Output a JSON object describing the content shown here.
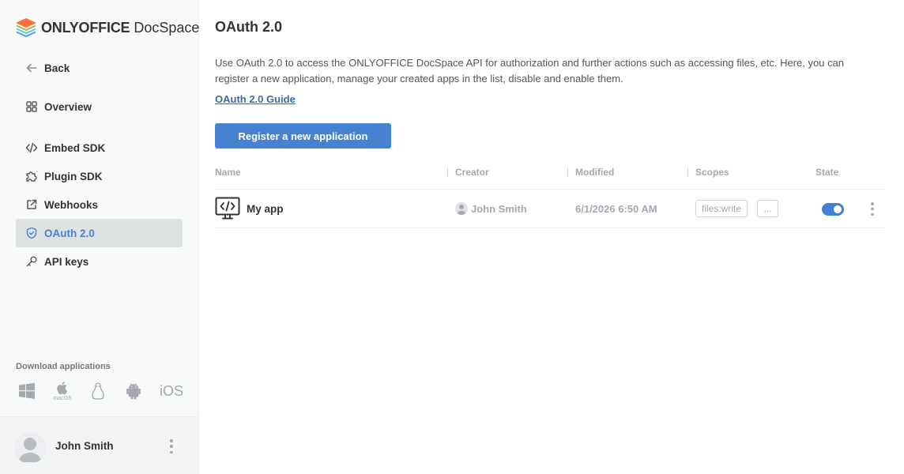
{
  "logo": {
    "brand_bold": "ONLYOFFICE",
    "brand_light": "DocSpace"
  },
  "sidebar": {
    "items": [
      {
        "label": "Back",
        "icon": "arrow-left-icon"
      },
      {
        "label": "Overview",
        "icon": "grid-icon"
      },
      {
        "label": "Embed SDK",
        "icon": "code-icon"
      },
      {
        "label": "Plugin SDK",
        "icon": "puzzle-icon"
      },
      {
        "label": "Webhooks",
        "icon": "external-link-icon"
      },
      {
        "label": "OAuth 2.0",
        "icon": "shield-check-icon",
        "active": true
      },
      {
        "label": "API keys",
        "icon": "key-icon"
      }
    ],
    "download_title": "Download applications",
    "apps": [
      {
        "name": "windows-icon"
      },
      {
        "name": "macos-icon",
        "label": "macOS"
      },
      {
        "name": "linux-icon"
      },
      {
        "name": "android-icon"
      },
      {
        "name": "ios-icon",
        "label": "iOS"
      }
    ]
  },
  "profile": {
    "name": "John Smith"
  },
  "main": {
    "title": "OAuth 2.0",
    "description": "Use OAuth 2.0 to access the ONLYOFFICE DocSpace API for authorization and further actions such as accessing files, etc. Here, you can register a new application, manage your created apps in the list, disable and enable them.",
    "guide_link": "OAuth 2.0 Guide",
    "register_button": "Register a new application"
  },
  "table": {
    "headers": {
      "name": "Name",
      "creator": "Creator",
      "modified": "Modified",
      "scopes": "Scopes",
      "state": "State"
    },
    "rows": [
      {
        "name": "My app",
        "creator": "John Smith",
        "modified": "6/1/2026 6:50 AM",
        "scope": "files:write",
        "more_scopes": "...",
        "enabled": true
      }
    ]
  },
  "colors": {
    "accent": "#4781d1",
    "link": "#316daa",
    "muted": "#a3a9ae"
  }
}
